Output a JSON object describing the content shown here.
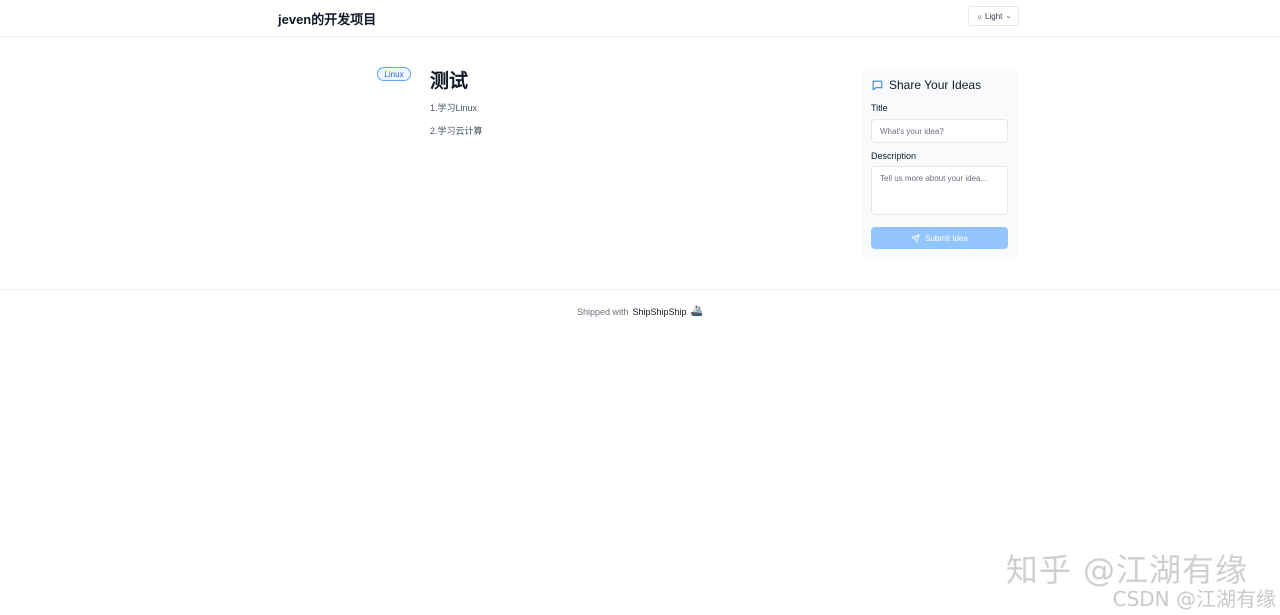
{
  "header": {
    "site_title": "jeven的开发项目",
    "theme_toggle": {
      "icon": "sun-icon",
      "label": "Light"
    }
  },
  "post": {
    "tag": "Linux",
    "title": "测试",
    "lines": [
      "1.学习Linux",
      "2.学习云计算"
    ]
  },
  "idea_form": {
    "heading": "Share Your Ideas",
    "title_label": "Title",
    "title_placeholder": "What's your idea?",
    "description_label": "Description",
    "description_placeholder": "Tell us more about your idea...",
    "submit_label": "Submit Idea"
  },
  "footer": {
    "prefix": "Shipped with",
    "link": "ShipShipShip",
    "emoji": "🚢"
  },
  "watermark": {
    "zhihu": "知乎 @江湖有缘",
    "csdn": "CSDN @江湖有缘"
  },
  "colors": {
    "accent": "#3b82f6",
    "button_disabled": "#93c5fd",
    "card_bg": "#f9fafb"
  }
}
